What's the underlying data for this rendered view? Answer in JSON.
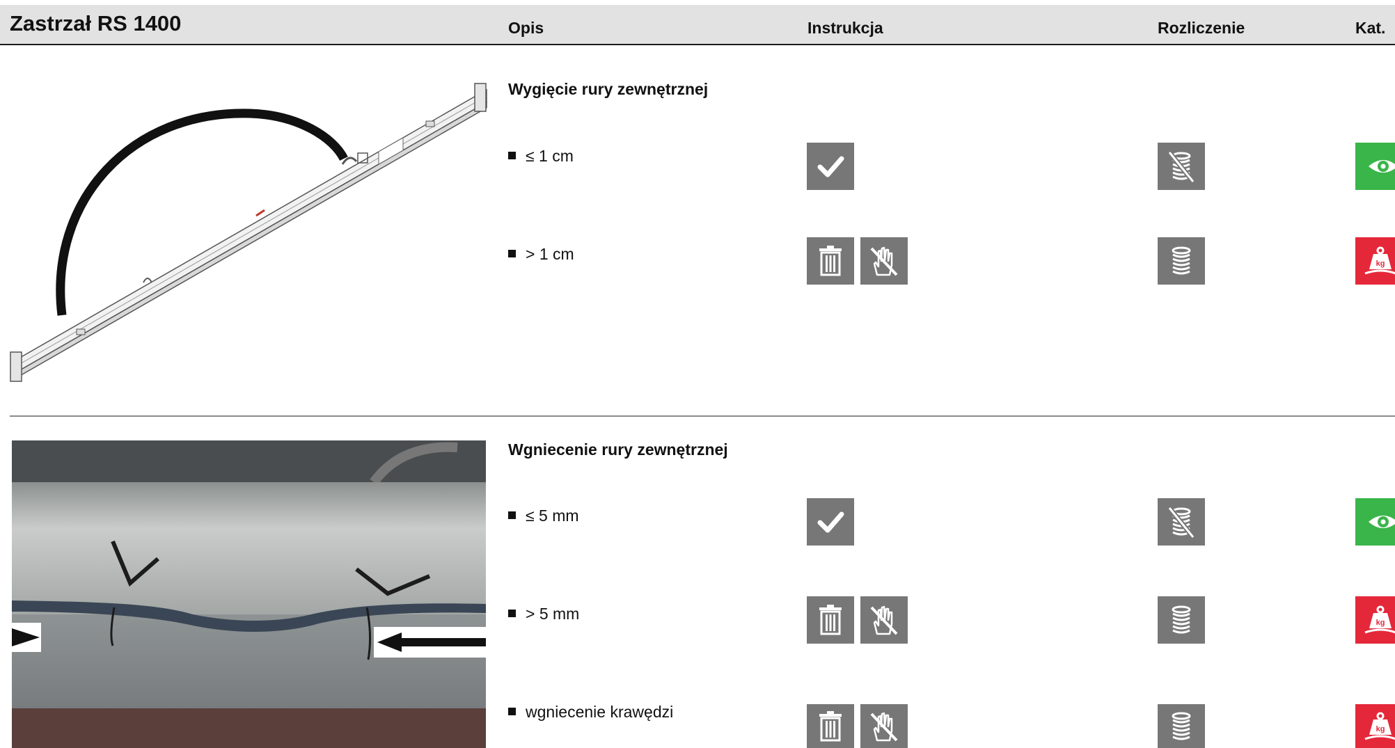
{
  "header": {
    "title": "Zastrzał RS 1400",
    "columns": {
      "opis": "Opis",
      "instrukcja": "Instrukcja",
      "rozliczenie": "Rozliczenie",
      "kat": "Kat."
    }
  },
  "sections": [
    {
      "title": "Wygięcie rury zewnętrznej",
      "image": "bent-brace-drawing",
      "items": [
        {
          "label": "≤ 1 cm",
          "instructions": [
            "check-icon"
          ],
          "billing": "no-charge-icon",
          "category": "eye-icon",
          "category_color": "#3ab54a"
        },
        {
          "label": "> 1 cm",
          "instructions": [
            "trash-icon",
            "no-touch-icon"
          ],
          "billing": "coins-icon",
          "category": "weight-kg-icon",
          "category_color": "#e4283a"
        }
      ]
    },
    {
      "title": "Wgniecenie rury zewnętrznej",
      "image": "dented-tube-photo",
      "items": [
        {
          "label": "≤ 5 mm",
          "instructions": [
            "check-icon"
          ],
          "billing": "no-charge-icon",
          "category": "eye-icon",
          "category_color": "#3ab54a"
        },
        {
          "label": "> 5 mm",
          "instructions": [
            "trash-icon",
            "no-touch-icon"
          ],
          "billing": "coins-icon",
          "category": "weight-kg-icon",
          "category_color": "#e4283a"
        },
        {
          "label": "wgniecenie krawędzi",
          "instructions": [
            "trash-icon",
            "no-touch-icon"
          ],
          "billing": "coins-icon",
          "category": "weight-kg-icon",
          "category_color": "#e4283a"
        }
      ]
    }
  ],
  "icon_label": "kg"
}
